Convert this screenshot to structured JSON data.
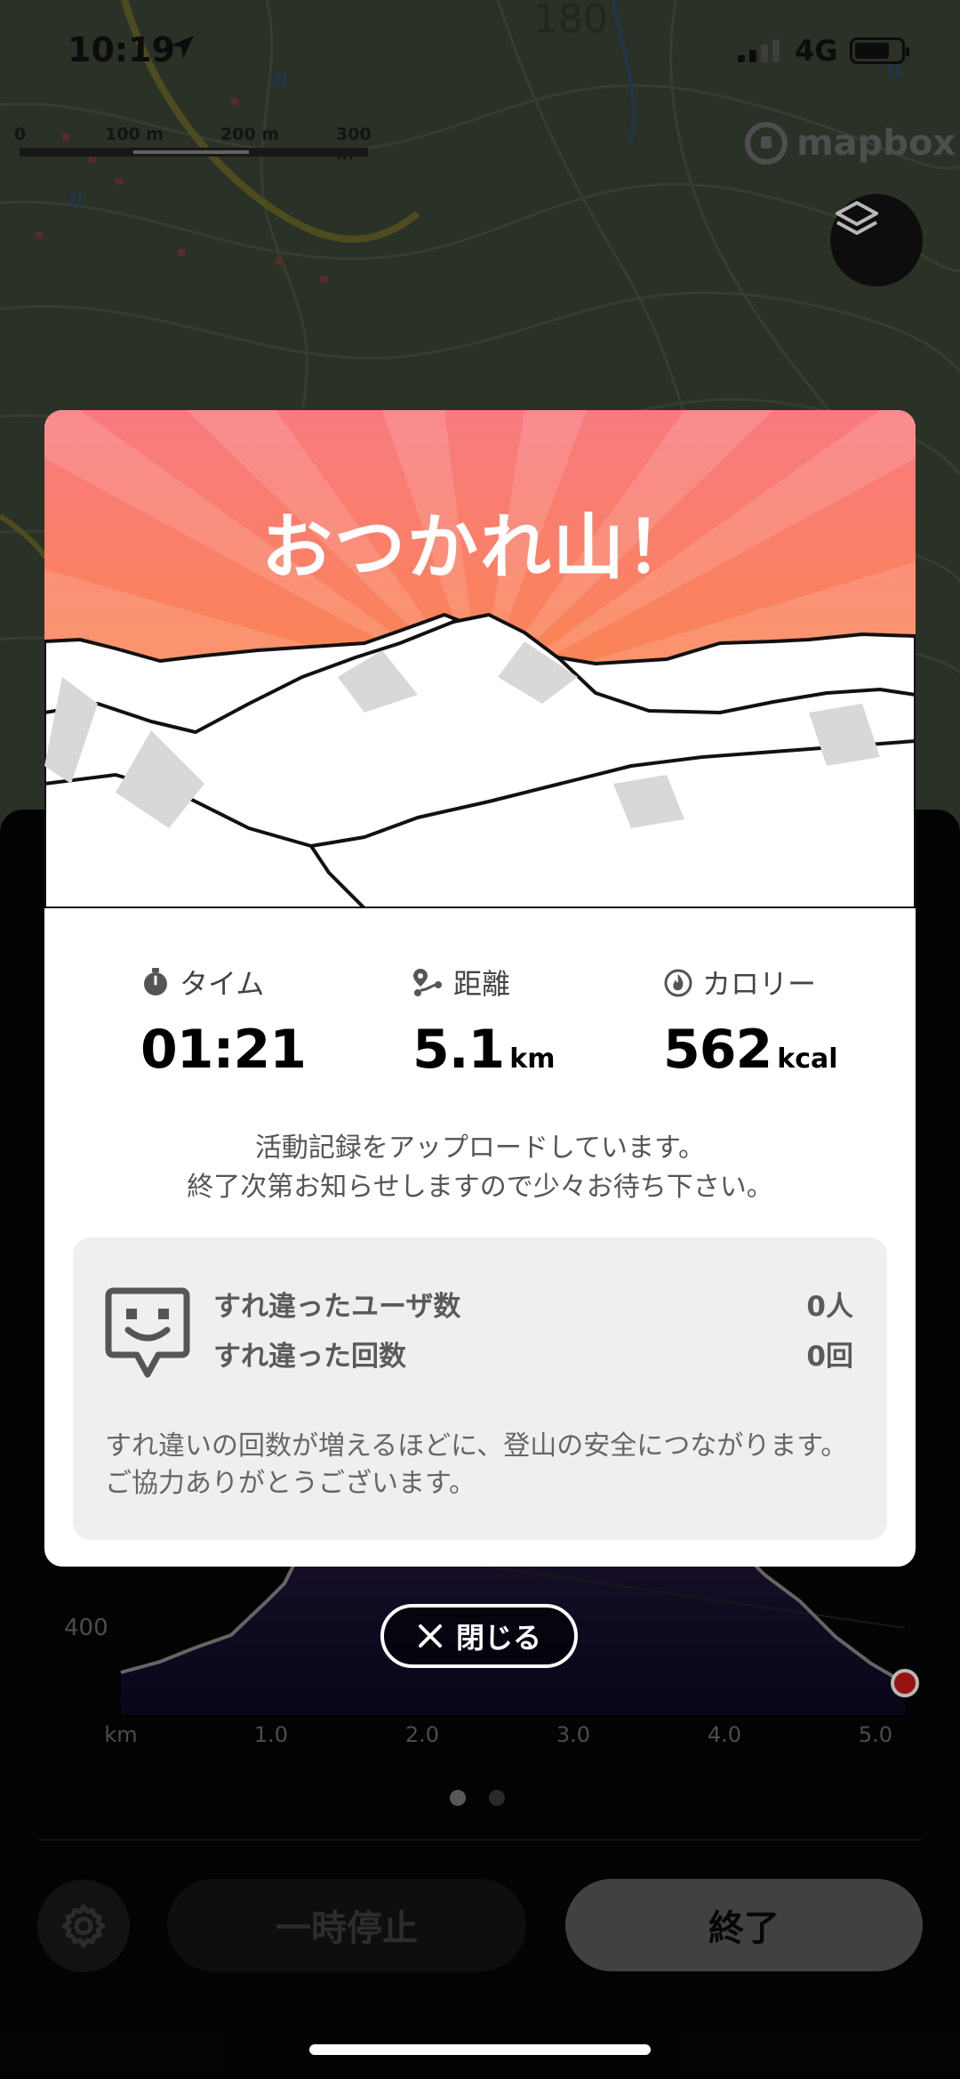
{
  "status_bar": {
    "time": "10:19",
    "network": "4G"
  },
  "map": {
    "scale_labels": [
      "0",
      "100 m",
      "200 m",
      "300 m"
    ],
    "attribution": "mapbox",
    "contour_label": "180"
  },
  "modal": {
    "title": "おつかれ山！",
    "stats": {
      "time": {
        "label": "タイム",
        "value": "01:21",
        "unit": ""
      },
      "distance": {
        "label": "距離",
        "value": "5.1",
        "unit": "km"
      },
      "calories": {
        "label": "カロリー",
        "value": "562",
        "unit": "kcal"
      }
    },
    "upload_message": [
      "活動記録をアップロードしています。",
      "終了次第お知らせしますので少々お待ち下さい。"
    ],
    "passing": {
      "users_label": "すれ違ったユーザ数",
      "users_value": "0人",
      "count_label": "すれ違った回数",
      "count_value": "0回",
      "note": "すれ違いの回数が増えるほどに、登山の安全につながります。ご協力ありがとうございます。"
    }
  },
  "close_button": {
    "label": "閉じる"
  },
  "chart": {
    "y_tick": "400",
    "x_ticks": [
      "km",
      "1.0",
      "2.0",
      "3.0",
      "4.0",
      "5.0"
    ]
  },
  "controls": {
    "pause_label": "一時停止",
    "end_label": "終了"
  },
  "pager": {
    "count": 2,
    "active": 0
  },
  "colors": {
    "hero_top": "#f57b7c",
    "hero_bottom": "#fb8a3a",
    "route_marker": "#d11a1a"
  }
}
